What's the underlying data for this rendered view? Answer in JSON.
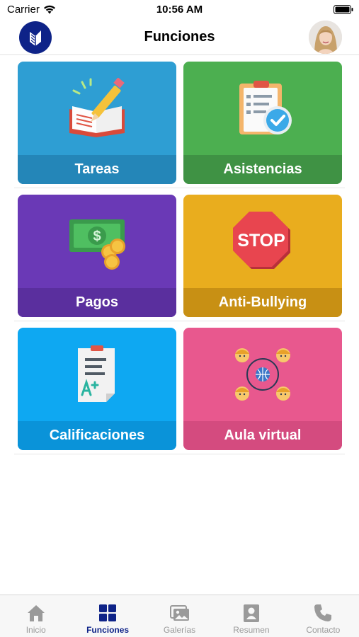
{
  "status": {
    "carrier": "Carrier",
    "time": "10:56 AM"
  },
  "header": {
    "title": "Funciones"
  },
  "tiles": [
    {
      "label": "Tareas",
      "color": "#2e9ed3",
      "label_bg": "#2486b8"
    },
    {
      "label": "Asistencias",
      "color": "#4caf50",
      "label_bg": "#3f9244"
    },
    {
      "label": "Pagos",
      "color": "#6a39b6",
      "label_bg": "#5a2f9e"
    },
    {
      "label": "Anti-Bullying",
      "color": "#e9ad1e",
      "label_bg": "#c89014"
    },
    {
      "label": "Calificaciones",
      "color": "#0ea8f2",
      "label_bg": "#0a93d9"
    },
    {
      "label": "Aula virtual",
      "color": "#e8588e",
      "label_bg": "#d44b7f"
    }
  ],
  "tabs": [
    {
      "label": "Inicio",
      "icon": "home-icon"
    },
    {
      "label": "Funciones",
      "icon": "grid-icon",
      "active": true
    },
    {
      "label": "Galerías",
      "icon": "gallery-icon"
    },
    {
      "label": "Resumen",
      "icon": "id-card-icon"
    },
    {
      "label": "Contacto",
      "icon": "phone-icon"
    }
  ],
  "art": {
    "stop_sign_text": "STOP",
    "money_symbol": "$"
  }
}
